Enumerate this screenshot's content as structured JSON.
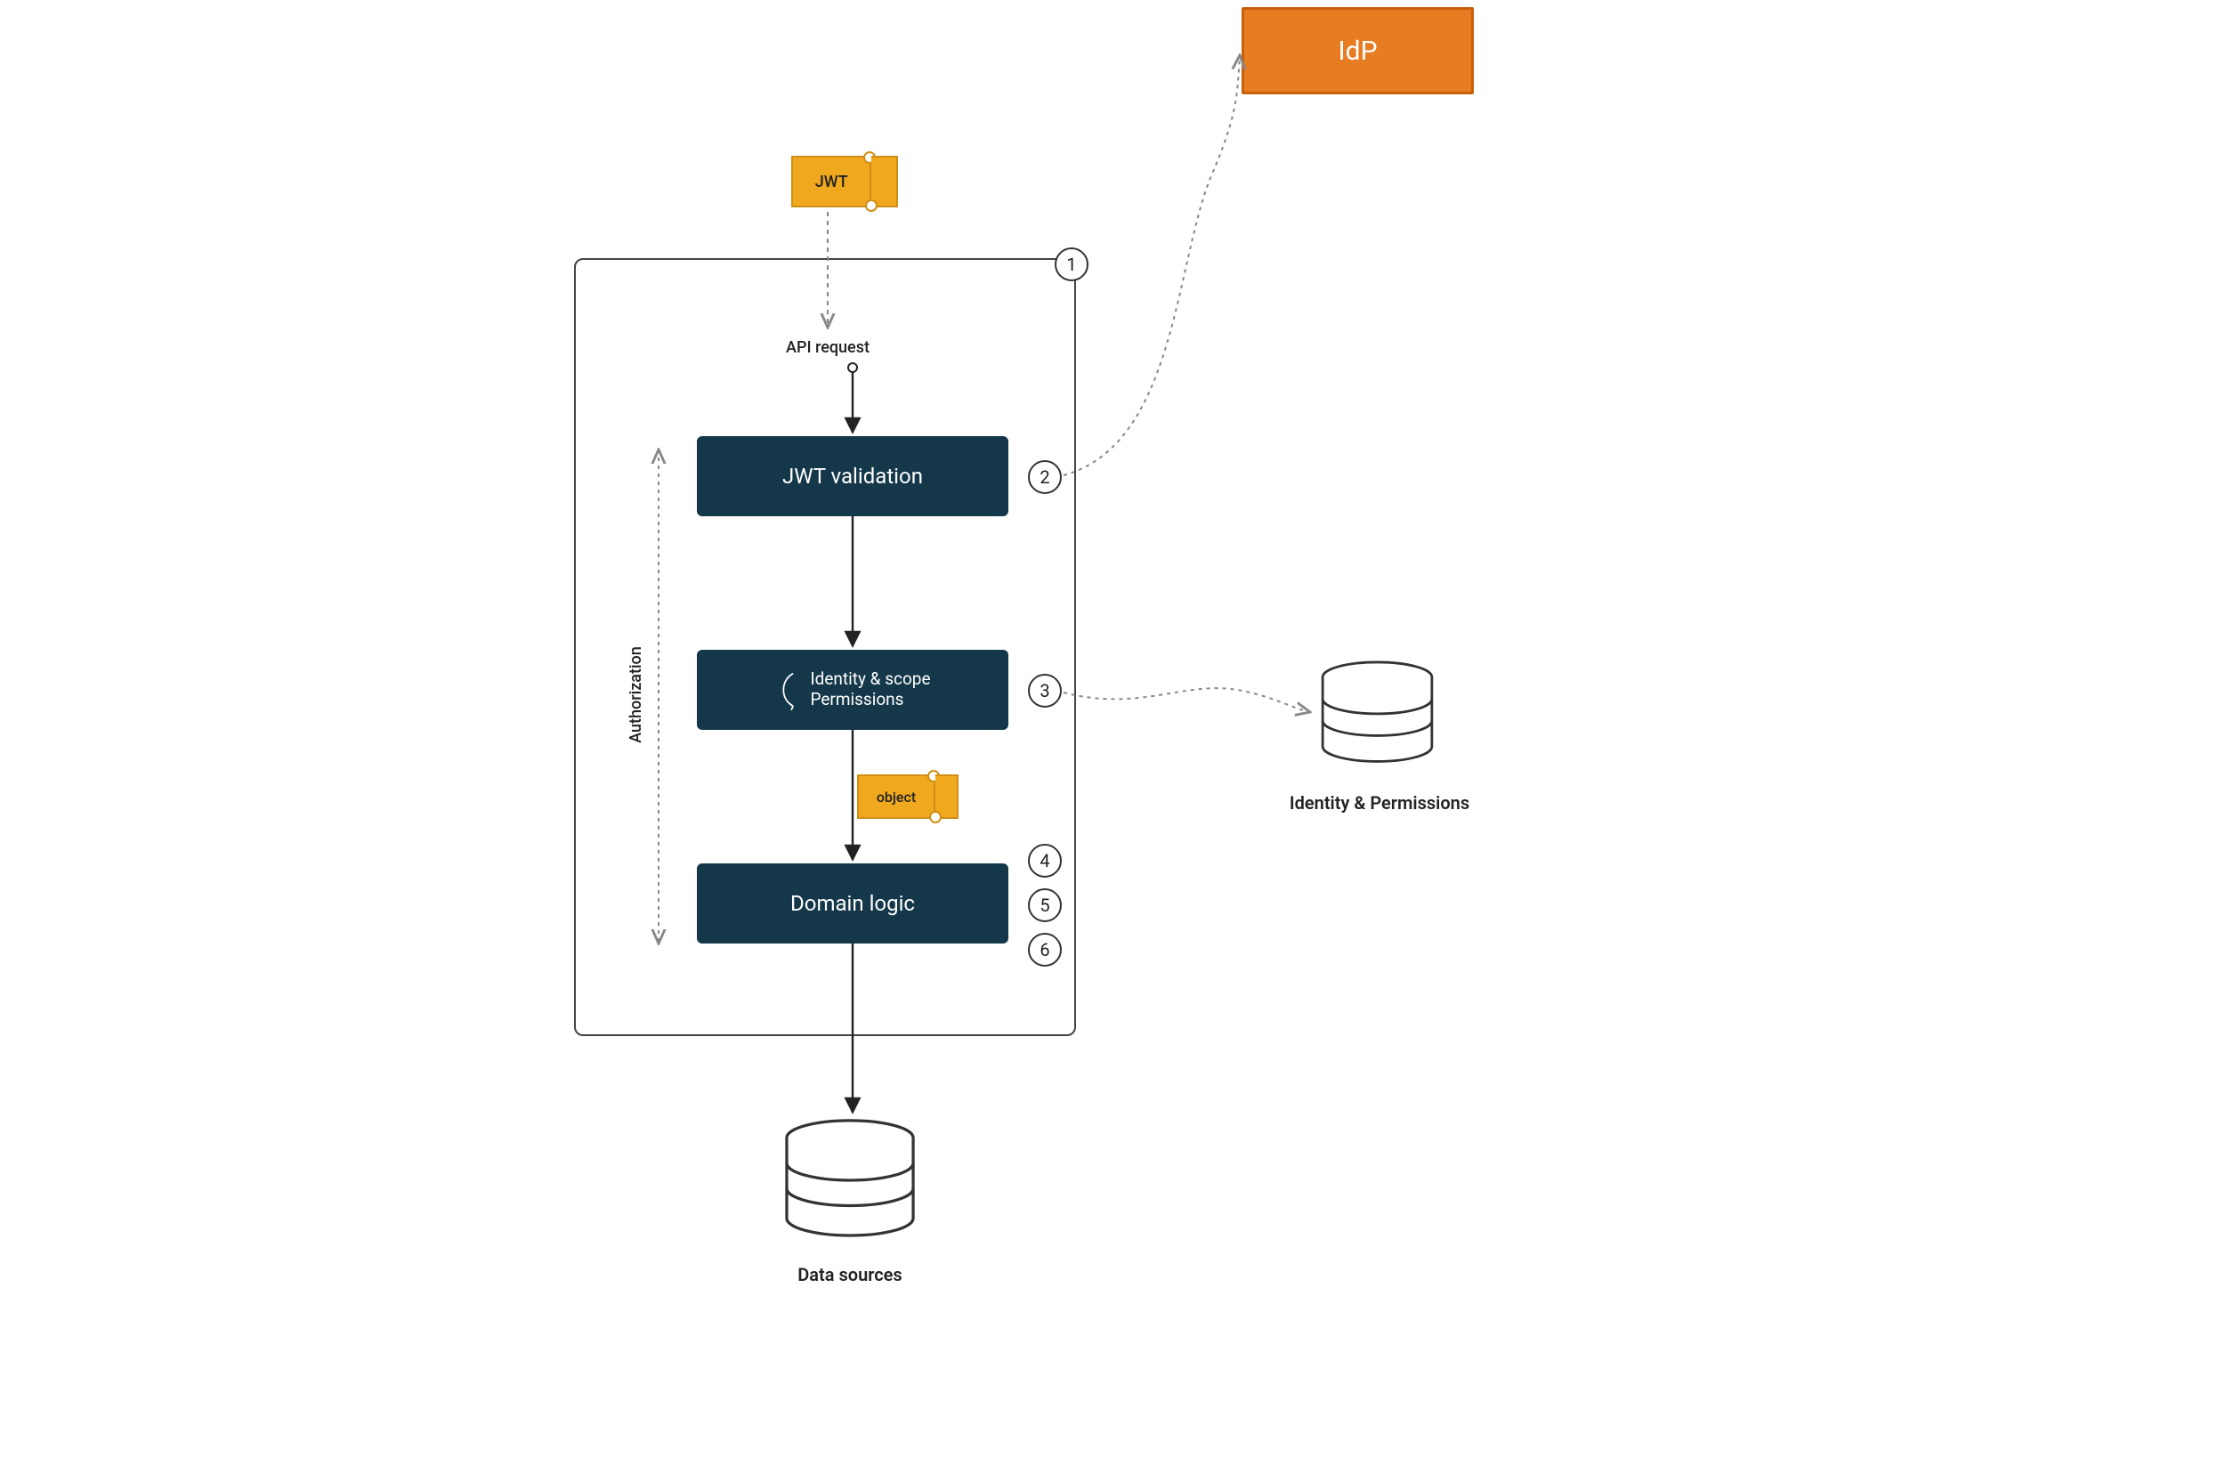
{
  "nodes": {
    "idp": "IdP",
    "jwt_validation": "JWT validation",
    "identity_line1": "Identity & scope",
    "identity_line2": "Permissions",
    "domain_logic": "Domain logic"
  },
  "tickets": {
    "jwt": "JWT",
    "object": "object"
  },
  "labels": {
    "api_request": "API request",
    "authorization": "Authorization",
    "data_sources": "Data sources",
    "identity_permissions_db": "Identity & Permissions"
  },
  "steps": {
    "one": "1",
    "two": "2",
    "three": "3",
    "four": "4",
    "five": "5",
    "six": "6"
  },
  "colors": {
    "box_dark": "#14374a",
    "idp_fill": "#e77c22",
    "ticket_fill": "#f0a81e"
  },
  "flow": [
    {
      "from": "JWT ticket",
      "to": "API request entry",
      "style": "dashed"
    },
    {
      "from": "API request",
      "to": "JWT validation",
      "style": "solid"
    },
    {
      "from": "JWT validation",
      "to": "Identity & scope / Permissions",
      "style": "solid"
    },
    {
      "from": "Identity & scope / Permissions",
      "to": "Domain logic",
      "style": "solid",
      "carries": "object ticket"
    },
    {
      "from": "Domain logic",
      "to": "Data sources",
      "style": "solid"
    },
    {
      "from": "JWT validation",
      "to": "IdP",
      "style": "dashed-curve"
    },
    {
      "from": "Identity & scope / Permissions",
      "to": "Identity & Permissions DB",
      "style": "dashed-curve"
    },
    {
      "side": "Authorization brace",
      "spans": [
        "JWT validation",
        "Domain logic"
      ],
      "style": "double-arrow dashed"
    }
  ]
}
